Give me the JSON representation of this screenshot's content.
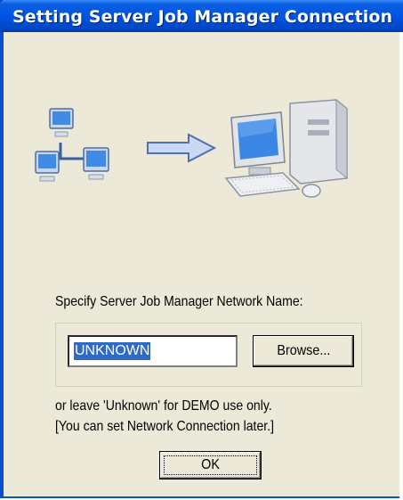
{
  "window": {
    "title": "Setting Server Job Manager Connection"
  },
  "dialog": {
    "prompt": "Specify Server Job Manager Network Name:",
    "network_name_value": "UNKNOWN",
    "browse_label": "Browse...",
    "note_line1": "or leave 'Unknown' for DEMO use only.",
    "note_line2": "[You can set Network Connection later.]",
    "ok_label": "OK"
  },
  "icons": {
    "network": "network-computers-icon",
    "arrow": "arrow-right-icon",
    "computer": "desktop-computer-icon"
  },
  "colors": {
    "titlebar": "#0054e3",
    "dialog_bg": "#ece9d8",
    "selection": "#316ac5"
  }
}
